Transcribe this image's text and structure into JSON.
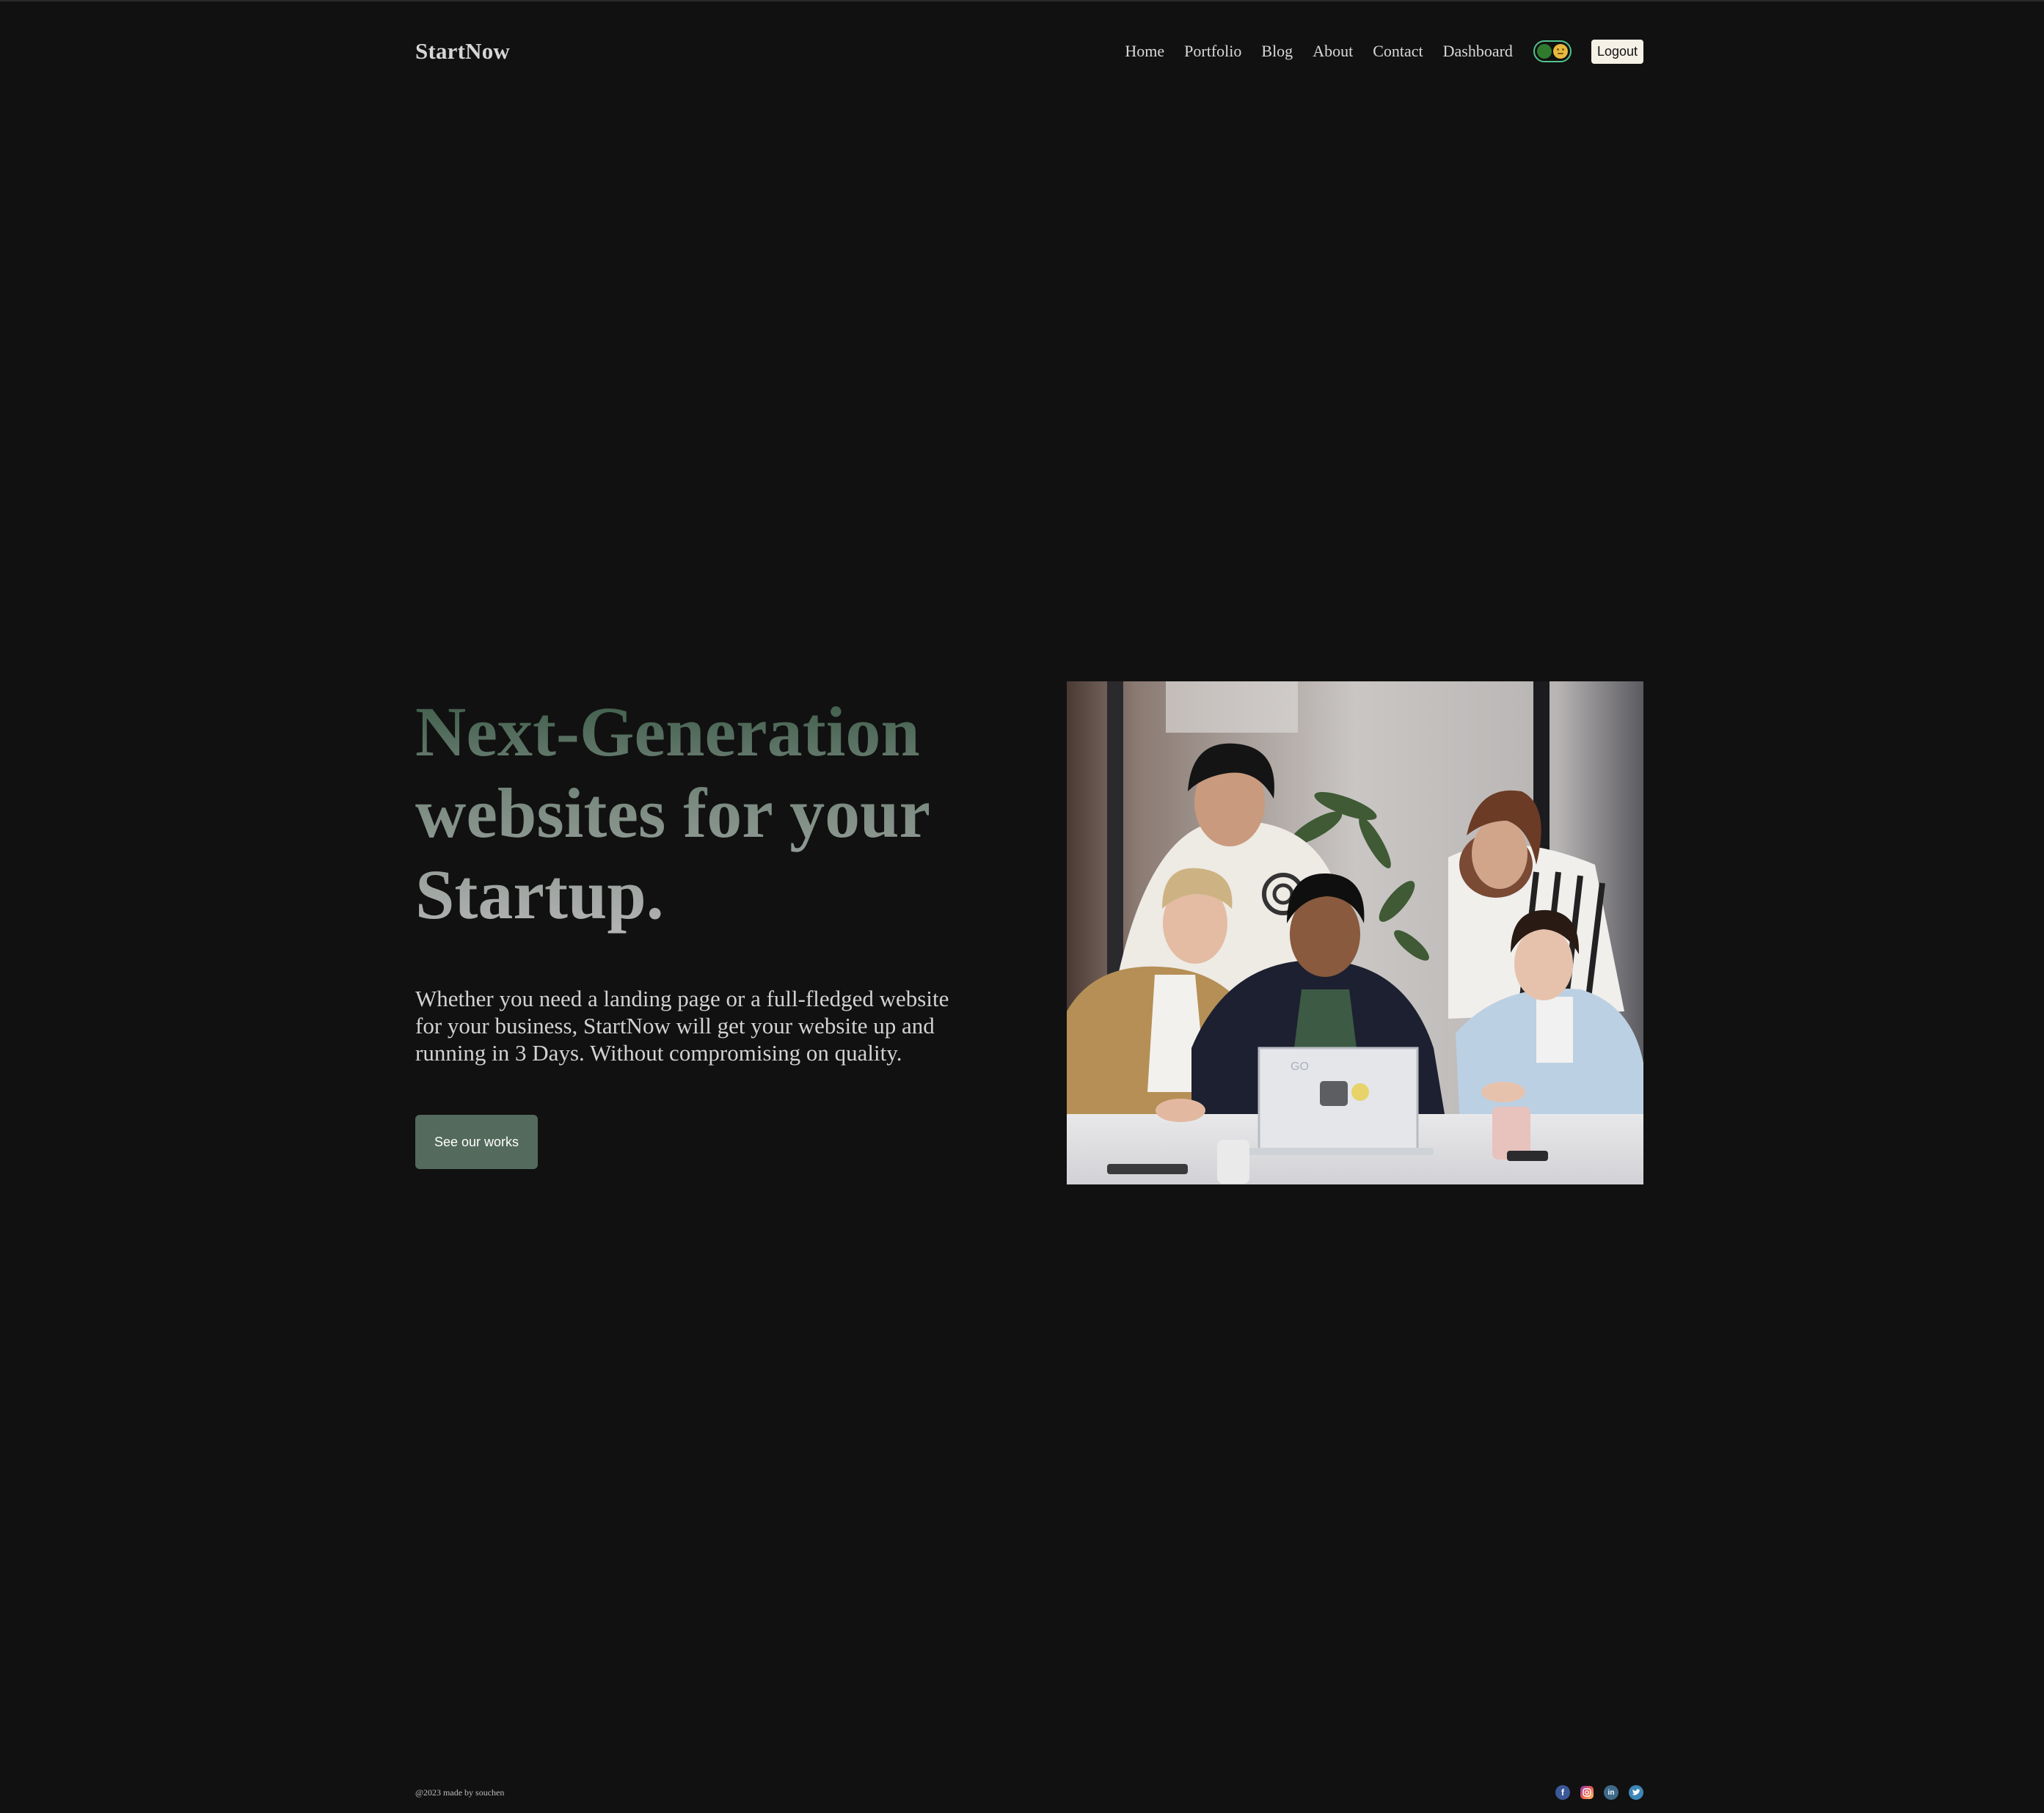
{
  "navbar": {
    "logo": "StartNow",
    "links": [
      "Home",
      "Portfolio",
      "Blog",
      "About",
      "Contact",
      "Dashboard"
    ],
    "logout_label": "Logout",
    "toggle_icons": [
      "dark-mode-ball-icon",
      "smiling-moon-icon"
    ]
  },
  "hero": {
    "title_line1": "Next-Generation",
    "title_line2": "websites for your",
    "title_line3": "Startup.",
    "description": "Whether you need a landing page or a full-fledged website for your business, StartNow will get your website up and running in 3 Days. Without compromising on quality.",
    "cta_label": "See our works",
    "image_desc": "team-around-laptop-photo"
  },
  "footer": {
    "copyright": "@2023 made by souchen",
    "social_icons": [
      "facebook-icon",
      "instagram-icon",
      "linkedin-icon",
      "twitter-icon"
    ]
  },
  "colors": {
    "background": "#111111",
    "accent": "#536a5c",
    "title_top": "#3b5a47",
    "logout_bg": "#f6f1e6"
  }
}
